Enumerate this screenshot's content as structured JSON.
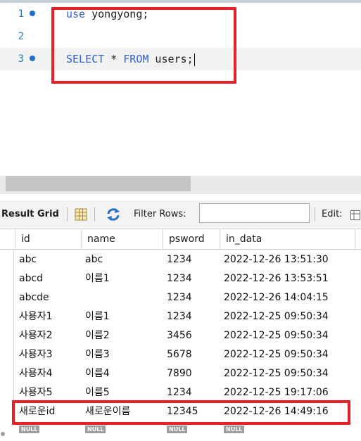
{
  "editor": {
    "lines": [
      {
        "num": "1",
        "kw": "use",
        "rest": " yongyong;"
      },
      {
        "num": "2",
        "kw": "",
        "rest": ""
      },
      {
        "num": "3",
        "kw": "SELECT",
        "rest_a": " * ",
        "kw2": "FROM",
        "rest_b": " users;"
      }
    ]
  },
  "toolbar": {
    "title": "Result Grid",
    "filter_label": "Filter Rows:",
    "filter_value": "",
    "edit_label": "Edit:"
  },
  "grid": {
    "columns": [
      "id",
      "name",
      "psword",
      "in_data"
    ],
    "rows": [
      [
        "abc",
        "abc",
        "1234",
        "2022-12-26 13:51:30"
      ],
      [
        "abcd",
        "이름1",
        "1234",
        "2022-12-26 13:53:51"
      ],
      [
        "abcde",
        "",
        "1234",
        "2022-12-26 14:04:15"
      ],
      [
        "사용자1",
        "이름1",
        "1234",
        "2022-12-25 09:50:34"
      ],
      [
        "사용자2",
        "이름2",
        "3456",
        "2022-12-25 09:50:34"
      ],
      [
        "사용자3",
        "이름3",
        "5678",
        "2022-12-25 09:50:34"
      ],
      [
        "사용자4",
        "이름4",
        "7890",
        "2022-12-25 09:50:34"
      ],
      [
        "사용자5",
        "이름5",
        "1234",
        "2022-12-25 19:17:06"
      ],
      [
        "새로운id",
        "새로운이름",
        "12345",
        "2022-12-26 14:49:16"
      ]
    ],
    "new_row": [
      "NULL",
      "NULL",
      "NULL",
      "NULL"
    ]
  },
  "colors": {
    "highlight": "#e8202a",
    "keyword": "#2f5fd0",
    "line_number": "#2b7bc0"
  }
}
